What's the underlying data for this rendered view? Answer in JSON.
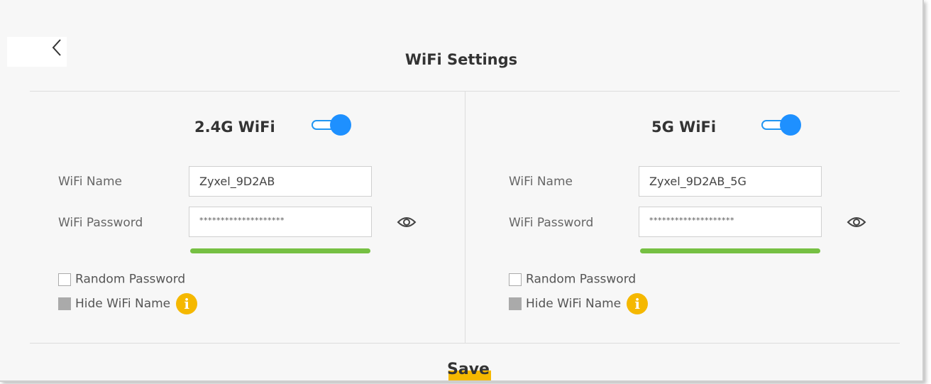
{
  "page": {
    "title": "WiFi Settings"
  },
  "colors": {
    "toggle_on": "#1e90ff",
    "strength": "#76c043",
    "info": "#f5b800",
    "save_accent": "#f5b800"
  },
  "band_24": {
    "title": "2.4G WiFi",
    "enabled": true,
    "name_label": "WiFi Name",
    "name_value": "Zyxel_9D2AB",
    "password_label": "WiFi Password",
    "password_value": "********************",
    "password_strength": 1.0,
    "random_password_label": "Random Password",
    "random_password_checked": false,
    "hide_name_label": "Hide WiFi Name",
    "info_glyph": "i"
  },
  "band_5": {
    "title": "5G WiFi",
    "enabled": true,
    "name_label": "WiFi Name",
    "name_value": "Zyxel_9D2AB_5G",
    "password_label": "WiFi Password",
    "password_value": "********************",
    "password_strength": 1.0,
    "random_password_label": "Random Password",
    "random_password_checked": false,
    "hide_name_label": "Hide WiFi Name",
    "info_glyph": "i"
  },
  "actions": {
    "save_label": "Save"
  },
  "icons": {
    "back": "chevron-left-icon",
    "eye": "eye-icon",
    "info": "info-icon"
  }
}
